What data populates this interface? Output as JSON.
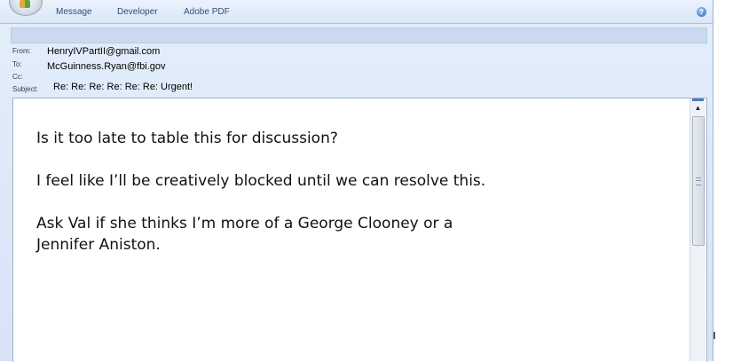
{
  "ribbon": {
    "tabs": [
      "Message",
      "Developer",
      "Adobe PDF"
    ],
    "help_icon": "help-icon"
  },
  "header": {
    "from_label": "From:",
    "from_value": "HenryIVPartII@gmail.com",
    "to_label": "To:",
    "to_value": "McGuinness.Ryan@fbi.gov",
    "cc_label": "Cc:",
    "cc_value": "",
    "subject_label": "Subject:",
    "subject_value": "Re: Re: Re: Re: Re: Re: Urgent!"
  },
  "body": {
    "lines": [
      "Is it too late to table this for discussion?",
      "I feel like I’ll be creatively blocked until we can resolve this.",
      "Ask Val if she thinks I’m more of a George Clooney or a",
      "Jennifer Aniston."
    ]
  },
  "scrollbar": {
    "up_arrow_icon": "chevron-up-icon",
    "grip_icon": "grip-icon"
  },
  "colors": {
    "chrome": "#d6e4f6",
    "tab_text": "#2f4f7a",
    "info_bar": "#c9d9ee",
    "scroll_accent": "#4a7cc0"
  }
}
